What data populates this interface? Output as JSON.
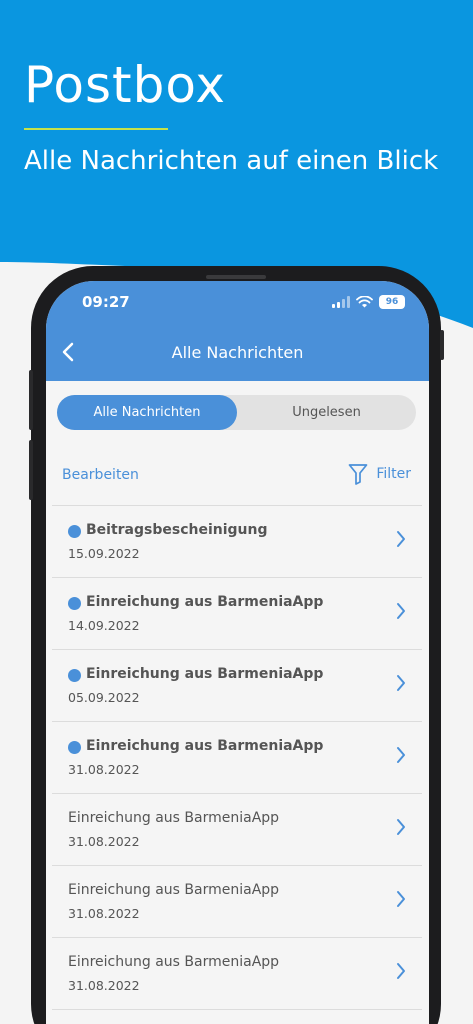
{
  "promo": {
    "title": "Postbox",
    "subtitle": "Alle Nachrichten auf einen Blick",
    "colors": {
      "background_blue": "#0a96e0",
      "underline": "#c6e24a"
    }
  },
  "status_bar": {
    "time": "09:27",
    "battery": "96"
  },
  "app_bar": {
    "title": "Alle Nachrichten",
    "back_icon": "chevron-left-icon",
    "color": "#4a90d9"
  },
  "segments": {
    "all": "Alle Nachrichten",
    "unread": "Ungelesen",
    "selected": "all"
  },
  "toolbar": {
    "edit": "Bearbeiten",
    "filter": "Filter",
    "filter_icon": "filter-icon"
  },
  "messages": [
    {
      "title": "Beitragsbescheinigung",
      "date": "15.09.2022",
      "unread": true
    },
    {
      "title": "Einreichung aus BarmeniaApp",
      "date": "14.09.2022",
      "unread": true
    },
    {
      "title": "Einreichung aus BarmeniaApp",
      "date": "05.09.2022",
      "unread": true
    },
    {
      "title": "Einreichung aus BarmeniaApp",
      "date": "31.08.2022",
      "unread": true
    },
    {
      "title": "Einreichung aus BarmeniaApp",
      "date": "31.08.2022",
      "unread": false
    },
    {
      "title": "Einreichung aus BarmeniaApp",
      "date": "31.08.2022",
      "unread": false
    },
    {
      "title": "Einreichung aus BarmeniaApp",
      "date": "31.08.2022",
      "unread": false
    }
  ]
}
